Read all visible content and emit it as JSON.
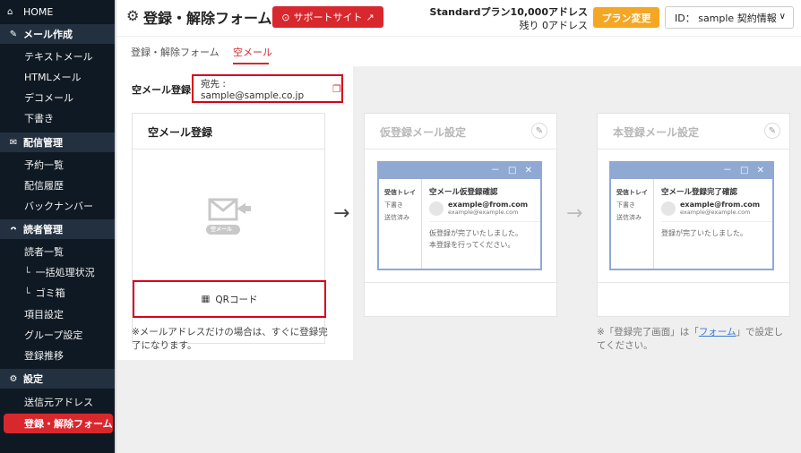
{
  "sidebar": {
    "home": "HOME",
    "sections": [
      {
        "label": "メール作成",
        "items": [
          "テキストメール",
          "HTMLメール",
          "デコメール",
          "下書き"
        ]
      },
      {
        "label": "配信管理",
        "items": [
          "予約一覧",
          "配信履歴",
          "バックナンバー"
        ]
      },
      {
        "label": "読者管理",
        "items": [
          "読者一覧",
          "一括処理状況",
          "ゴミ箱",
          "項目設定",
          "グループ設定",
          "登録推移"
        ]
      },
      {
        "label": "設定",
        "items": [
          "送信元アドレス",
          "登録・解除フォーム"
        ]
      }
    ],
    "active_item": "登録・解除フォーム"
  },
  "header": {
    "title": "登録・解除フォーム",
    "support_button": "サポートサイト",
    "plan_name": "Standardプラン10,000アドレス",
    "plan_remaining": "残り 0アドレス",
    "plan_change_button": "プラン変更",
    "account_dropdown": "ID： sample  契約情報"
  },
  "tabs": [
    {
      "label": "登録・解除フォーム",
      "active": false
    },
    {
      "label": "空メール",
      "active": true
    }
  ],
  "empty_mail": {
    "label": "空メール登録",
    "address": "宛先 : sample@sample.co.jp"
  },
  "cards": {
    "register": {
      "title": "空メール登録",
      "icon_caption": "空メール",
      "qr_button": "QRコード",
      "note": "※メールアドレスだけの場合は、すぐに登録完了になります。"
    },
    "temp": {
      "title": "仮登録メール設定",
      "mail": {
        "folders": [
          "受信トレイ",
          "下書き",
          "送信済み"
        ],
        "subject": "空メール仮登録確認",
        "from_name": "example@from.com",
        "from_addr": "example@example.com",
        "body": [
          "仮登録が完了いたしました。",
          "本登録を行ってください。"
        ]
      }
    },
    "final": {
      "title": "本登録メール設定",
      "mail": {
        "folders": [
          "受信トレイ",
          "下書き",
          "送信済み"
        ],
        "subject": "空メール登録完了確認",
        "from_name": "example@from.com",
        "from_addr": "example@example.com",
        "body": [
          "登録が完了いたしました。"
        ]
      },
      "note_prefix": "※「登録完了画面」は「",
      "note_link": "フォーム",
      "note_suffix": "」で設定してください。"
    }
  },
  "window_controls": "－ □ ✕",
  "colors": {
    "accent": "#d9272e",
    "sidebar_bg": "#0f1923",
    "section_bg": "#22303f",
    "plan_button": "#f5a623",
    "window_frame": "#8fa9d3"
  }
}
